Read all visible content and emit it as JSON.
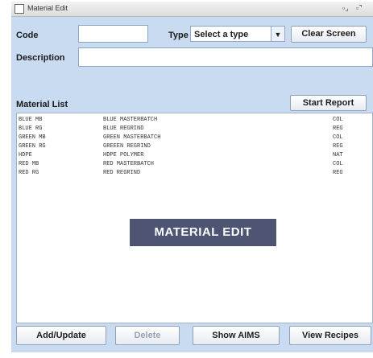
{
  "window": {
    "title": "Material Edit",
    "controls": [
      "▫⌟",
      "▫⌝"
    ]
  },
  "form": {
    "code_label": "Code",
    "code_value": "",
    "type_label": "Type",
    "type_selected": "Select a type",
    "clear_screen": "Clear Screen",
    "description_label": "Description",
    "description_value": ""
  },
  "list": {
    "label": "Material List",
    "start_report": "Start Report",
    "rows": [
      {
        "code": "BLUE MB",
        "description": "BLUE MASTERBATCH",
        "type": "COL"
      },
      {
        "code": "BLUE RG",
        "description": "BLUE REGRIND",
        "type": "REG"
      },
      {
        "code": "GREEN MB",
        "description": "GREEN MASTERBATCH",
        "type": "COL"
      },
      {
        "code": "GREEN RG",
        "description": "GREEEN REGRIND",
        "type": "REG"
      },
      {
        "code": "HDPE",
        "description": "HDPE POLYMER",
        "type": "NAT"
      },
      {
        "code": "RED MB",
        "description": "RED MASTERBATCH",
        "type": "COL"
      },
      {
        "code": "RED RG",
        "description": "RED REGRIND",
        "type": "REG"
      }
    ]
  },
  "banner": "MATERIAL EDIT",
  "buttons": {
    "add_update": "Add/Update",
    "delete": "Delete",
    "show_aims": "Show AIMS",
    "view_recipes": "View Recipes"
  },
  "colors": {
    "panel": "#c9dbf1",
    "banner": "#4d5573"
  }
}
